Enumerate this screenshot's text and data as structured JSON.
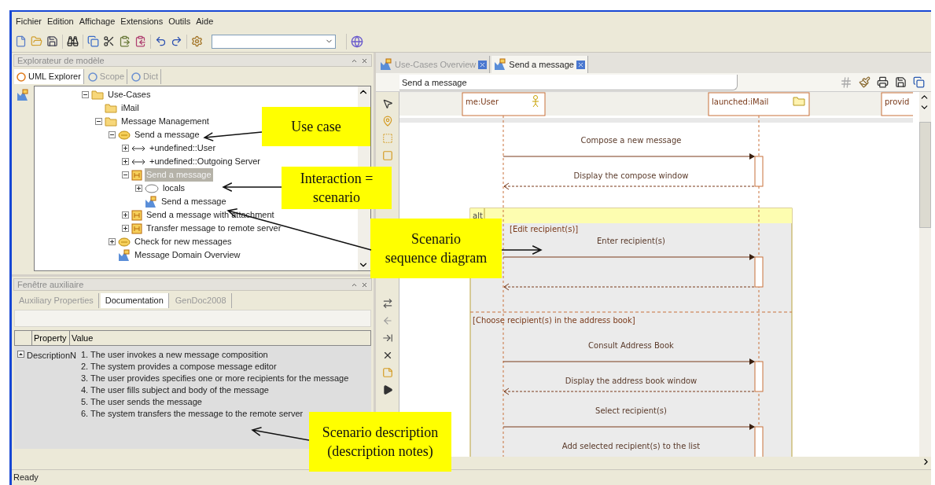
{
  "menu": [
    {
      "label": "Fichier"
    },
    {
      "label": "Edition"
    },
    {
      "label": "Affichage"
    },
    {
      "label": "Extensions"
    },
    {
      "label": "Outils"
    },
    {
      "label": "Aide"
    }
  ],
  "explorer": {
    "title": "Explorateur de modèle",
    "tabs": [
      {
        "label": "UML Explorer",
        "selected": true
      },
      {
        "label": "Scope",
        "selected": false
      },
      {
        "label": "Dict",
        "selected": false
      }
    ],
    "tree": [
      {
        "label": "Use-Cases",
        "kind": "folder",
        "expanded": true,
        "selected": false,
        "children": [
          {
            "label": "iMail",
            "kind": "folder",
            "selected": false
          },
          {
            "label": "Message Management",
            "kind": "folder",
            "expanded": true,
            "selected": false,
            "children": [
              {
                "label": "Send a message",
                "kind": "usecase",
                "expanded": true,
                "selected": false,
                "children": [
                  {
                    "label": "+undefined::User",
                    "kind": "association",
                    "expanded": false,
                    "selected": false
                  },
                  {
                    "label": "+undefined::Outgoing Server",
                    "kind": "association",
                    "expanded": false,
                    "selected": false
                  },
                  {
                    "label": "Send a message",
                    "kind": "interaction",
                    "expanded": true,
                    "selected": true,
                    "children": [
                      {
                        "label": "locals",
                        "kind": "collaboration",
                        "expanded": false,
                        "selected": false
                      },
                      {
                        "label": "Send a message",
                        "kind": "diagram",
                        "selected": false
                      }
                    ]
                  },
                  {
                    "label": "Send a message with attachment",
                    "kind": "interaction",
                    "expanded": false,
                    "selected": false
                  },
                  {
                    "label": "Transfer message to remote server",
                    "kind": "interaction",
                    "expanded": false,
                    "selected": false
                  }
                ]
              },
              {
                "label": "Check for new messages",
                "kind": "usecase",
                "expanded": false,
                "selected": false
              },
              {
                "label": "Message Domain Overview",
                "kind": "diagram",
                "selected": false
              }
            ]
          }
        ]
      }
    ]
  },
  "auxiliary": {
    "title": "Fenêtre auxiliaire",
    "tabs": [
      {
        "label": "Auxiliary Properties",
        "selected": false
      },
      {
        "label": "Documentation",
        "selected": true
      },
      {
        "label": "GenDoc2008",
        "selected": false
      }
    ],
    "columns": [
      "Property",
      "Value"
    ],
    "rows": [
      {
        "property": "DescriptionN",
        "expanded": true,
        "lines": [
          "1. The user invokes a new message composition",
          "2. The system provides a compose message editor",
          "3. The user provides specifies one or more recipients for the message",
          "4. The user fills subject and body of the message",
          "5. The user sends the message",
          "6. The system transfers the message to the remote server"
        ]
      }
    ]
  },
  "editor": {
    "tabs": [
      {
        "label": "Use-Cases Overview",
        "selected": false
      },
      {
        "label": "Send a message",
        "selected": true
      }
    ],
    "diagram_title": "Send a message",
    "lifelines": [
      {
        "name": "me:User",
        "kind": "actor"
      },
      {
        "name": "launched:iMail",
        "kind": "folder"
      },
      {
        "name": "provid",
        "kind": "object"
      }
    ],
    "messages": [
      {
        "kind": "call",
        "label": "Compose a new message"
      },
      {
        "kind": "return",
        "label": "Display the compose window"
      }
    ],
    "fragment": {
      "operator": "alt",
      "operands": [
        {
          "guard": "[Edit recipient(s)]",
          "messages": [
            {
              "kind": "call",
              "label": "Enter recipient(s)"
            },
            {
              "kind": "return"
            }
          ]
        },
        {
          "guard": "[Choose recipient(s) in the address book]",
          "messages": [
            {
              "kind": "call",
              "label": "Consult Address Book"
            },
            {
              "kind": "return",
              "label": "Display the address book window"
            },
            {
              "kind": "call",
              "label": "Select recipient(s)"
            },
            {
              "kind": "note",
              "label": "Add selected recipient(s) to the list"
            }
          ]
        }
      ]
    }
  },
  "status_bar": "Ready",
  "callouts": [
    {
      "text": "Use case"
    },
    {
      "text": "Interaction =\nscenario"
    },
    {
      "text": "Scenario\nsequence diagram"
    },
    {
      "text": "Scenario description\n(description notes)"
    }
  ]
}
